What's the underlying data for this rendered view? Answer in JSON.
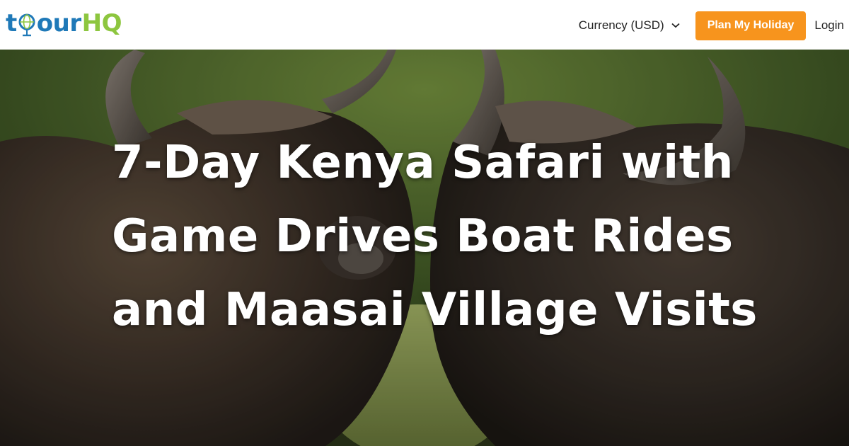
{
  "header": {
    "logo": {
      "t": "t",
      "our": "our",
      "hq": "HQ"
    },
    "currency_label": "Currency (USD)",
    "plan_button": "Plan My Holiday",
    "login": "Login",
    "colors": {
      "brand_blue": "#1f79b8",
      "brand_green": "#8dc63f",
      "cta_orange": "#f7941d"
    },
    "icons": {
      "globe": "globe-icon",
      "currency": "chevron-down-icon"
    }
  },
  "hero": {
    "image": "two-cape-buffalo-photo",
    "headline_lines": [
      "7-Day Kenya Safari with",
      "Game Drives Boat Rides",
      "and Maasai Village Visits"
    ]
  }
}
